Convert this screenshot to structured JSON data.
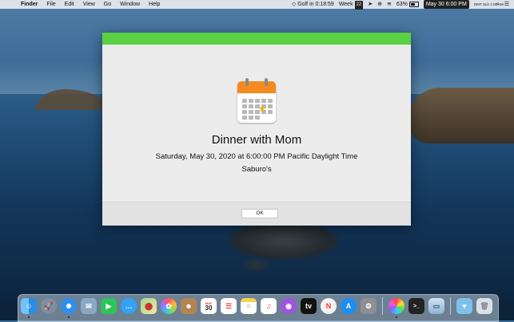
{
  "menubar": {
    "app": "Finder",
    "menus": [
      "File",
      "Edit",
      "View",
      "Go",
      "Window",
      "Help"
    ],
    "status": {
      "timer": "Golf in 0:18:59",
      "week_label": "Week",
      "week_number": "22",
      "battery": "63%",
      "clock": "May 30  6:00 PM",
      "gmt": "GMT Sun 1:00 AM"
    }
  },
  "dialog": {
    "event_title": "Dinner with Mom",
    "event_datetime": "Saturday, May 30, 2020 at 6:00:00 PM Pacific Daylight Time",
    "event_location": "Saburo's",
    "ok_label": "OK",
    "accent_color": "#5ad142",
    "calendar_icon_day_color": "#f58a1f"
  },
  "dock": {
    "calendar_day": "30",
    "calendar_month": "MAY",
    "apps": [
      "finder-icon",
      "launchpad-icon",
      "safari-icon",
      "mail-icon",
      "facetime-icon",
      "messages-icon",
      "maps-icon",
      "photos-icon",
      "contacts-icon",
      "calendar-icon",
      "reminders-icon",
      "notes-icon",
      "music-icon",
      "podcasts-icon",
      "tv-icon",
      "news-icon",
      "app-store-icon",
      "system-preferences-icon",
      "color-picker-icon",
      "terminal-icon",
      "preview-icon",
      "downloads-folder-icon",
      "trash-icon"
    ]
  }
}
